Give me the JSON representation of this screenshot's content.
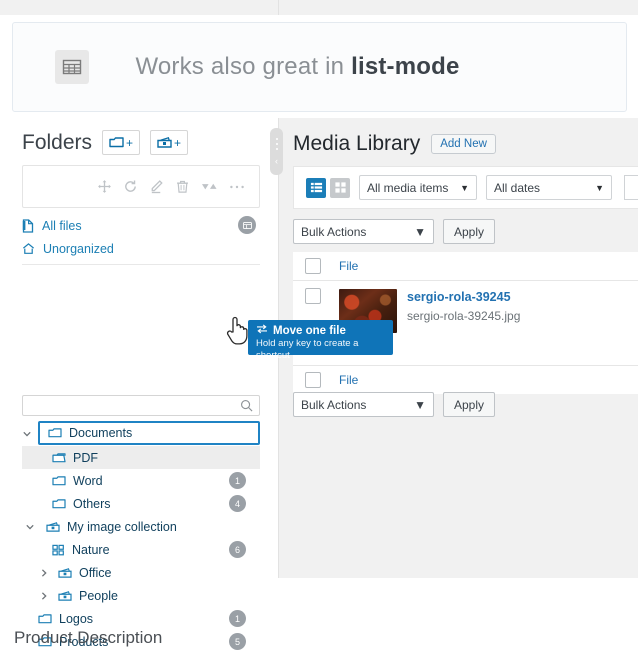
{
  "banner": {
    "icon": "table-grid-icon",
    "text_plain": "Works also great in ",
    "text_strong": "list-mode"
  },
  "folders_panel": {
    "title": "Folders",
    "new_folder_button": "+",
    "new_collection_button": "+",
    "toolbar": [
      {
        "name": "move-icon",
        "label": "Move"
      },
      {
        "name": "refresh-icon",
        "label": "Refresh"
      },
      {
        "name": "edit-icon",
        "label": "Rename"
      },
      {
        "name": "delete-icon",
        "label": "Delete"
      },
      {
        "name": "sort-icon",
        "label": "Sort"
      },
      {
        "name": "more-icon",
        "label": "More"
      }
    ],
    "quick_links": [
      {
        "label": "All files",
        "icon": "file-icon",
        "badge": ""
      },
      {
        "label": "Unorganized",
        "icon": "home-icon",
        "badge": ""
      }
    ],
    "search": {
      "value": "",
      "placeholder": ""
    },
    "tree": [
      {
        "label": "Documents",
        "icon": "folder-icon",
        "twisty": "expanded",
        "badge": "",
        "depth": 0,
        "state": "drop-target"
      },
      {
        "label": "PDF",
        "icon": "folder-open-icon",
        "twisty": "",
        "badge": "",
        "depth": 1,
        "state": "hovered"
      },
      {
        "label": "Word",
        "icon": "folder-icon",
        "twisty": "",
        "badge": "1",
        "depth": 1,
        "state": ""
      },
      {
        "label": "Others",
        "icon": "folder-icon",
        "twisty": "",
        "badge": "4",
        "depth": 1,
        "state": ""
      },
      {
        "label": "My image collection",
        "icon": "collection-icon",
        "twisty": "expanded",
        "badge": "",
        "depth": 0,
        "state": ""
      },
      {
        "label": "Nature",
        "icon": "grid-icon",
        "twisty": "",
        "badge": "6",
        "depth": 1,
        "state": ""
      },
      {
        "label": "Office",
        "icon": "collection-icon",
        "twisty": "collapsed",
        "badge": "",
        "depth": 1,
        "state": ""
      },
      {
        "label": "People",
        "icon": "collection-icon",
        "twisty": "collapsed",
        "badge": "",
        "depth": 1,
        "state": ""
      },
      {
        "label": "Logos",
        "icon": "folder-icon",
        "twisty": "",
        "badge": "1",
        "depth": 0,
        "state": ""
      },
      {
        "label": "Products",
        "icon": "folder-icon",
        "twisty": "",
        "badge": "5",
        "depth": 0,
        "state": ""
      }
    ]
  },
  "splitter": {
    "collapse_chevron": "‹"
  },
  "media": {
    "title": "Media Library",
    "add_new": "Add New",
    "view_modes": [
      {
        "name": "list-view-icon",
        "active": true
      },
      {
        "name": "grid-view-icon",
        "active": false
      }
    ],
    "filters": [
      {
        "name": "media-type-filter",
        "value": "All media items"
      },
      {
        "name": "date-filter",
        "value": "All dates"
      }
    ],
    "bulk_top": {
      "select_value": "Bulk Actions",
      "apply_label": "Apply"
    },
    "bulk_bottom": {
      "select_value": "Bulk Actions",
      "apply_label": "Apply"
    },
    "columns": [
      "File"
    ],
    "rows": [
      {
        "type": "header",
        "file": "File"
      },
      {
        "type": "item",
        "title": "sergio-rola-39245",
        "filename": "sergio-rola-39245.jpg",
        "thumb": "dark-red-photo"
      },
      {
        "type": "header",
        "file": "File"
      }
    ]
  },
  "drag_tooltip": {
    "icon": "move-swap-icon",
    "line1": "Move one file",
    "line2": "Hold any key to create a shortcut",
    "color": "#0f74b8"
  },
  "bottom": {
    "heading": "Product Description"
  },
  "colors": {
    "accent_blue": "#1b7eb8",
    "link_blue": "#2271b1",
    "tree_blue": "#0f3f5c",
    "page_gray": "#f1f1f1",
    "badge_gray": "#9aa0a6"
  }
}
